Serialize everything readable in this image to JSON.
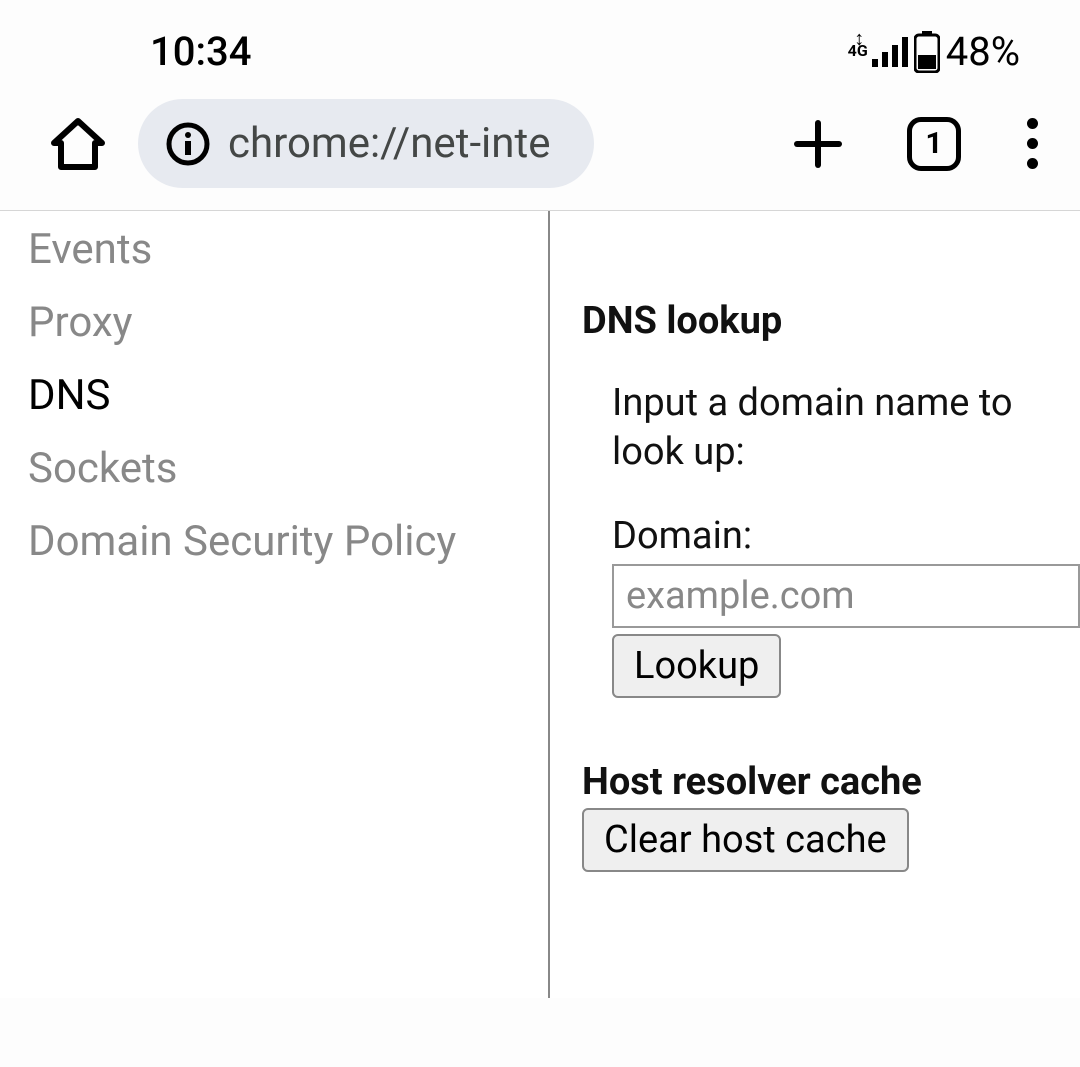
{
  "status": {
    "time": "10:34",
    "network_label": "4G",
    "battery_percent": "48%"
  },
  "toolbar": {
    "url": "chrome://net-inte",
    "tab_count": "1"
  },
  "sidebar": {
    "items": [
      {
        "label": "Events",
        "active": false
      },
      {
        "label": "Proxy",
        "active": false
      },
      {
        "label": "DNS",
        "active": true
      },
      {
        "label": "Sockets",
        "active": false
      },
      {
        "label": "Domain Security Policy",
        "active": false
      }
    ]
  },
  "main": {
    "dns_lookup_heading": "DNS lookup",
    "prompt": "Input a domain name to look up:",
    "domain_label": "Domain:",
    "domain_placeholder": "example.com",
    "lookup_button": "Lookup",
    "cache_heading": "Host resolver cache",
    "clear_button": "Clear host cache"
  }
}
